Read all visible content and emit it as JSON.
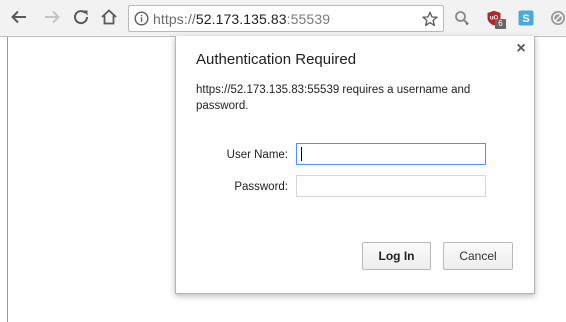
{
  "toolbar": {
    "url_scheme": "https://",
    "url_host": "52.173.135.83",
    "url_port": ":55539",
    "extension_badge": "6"
  },
  "dialog": {
    "title": "Authentication Required",
    "message": "https://52.173.135.83:55539 requires a username and password.",
    "username_label": "User Name:",
    "password_label": "Password:",
    "username_value": "",
    "password_value": "",
    "login_label": "Log In",
    "cancel_label": "Cancel",
    "close_glyph": "×"
  },
  "colors": {
    "toolbar_bg": "#f2f2f2",
    "focus_border": "#4d90fe",
    "extension_red": "#b4252c",
    "extension_blue": "#4aa8dd"
  }
}
